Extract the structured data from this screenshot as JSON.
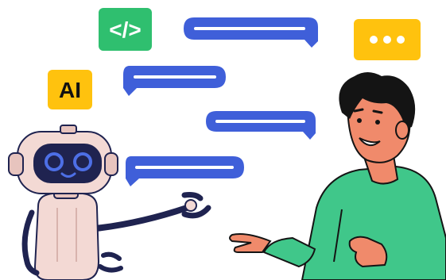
{
  "badges": {
    "code": {
      "text": "</>",
      "icon": "code-brackets-icon",
      "color": "#2fbf6f"
    },
    "ai": {
      "text": "AI",
      "color": "#ffc20e"
    },
    "typing": {
      "icon": "ellipsis-dots-icon",
      "color": "#ffc20e"
    }
  },
  "chat": {
    "bubble_color": "#3f5fd9",
    "line_color": "#ffffff",
    "bubbles": [
      {
        "side": "right",
        "icon": "speech-bubble-icon"
      },
      {
        "side": "left",
        "icon": "speech-bubble-icon"
      },
      {
        "side": "right",
        "icon": "speech-bubble-icon"
      },
      {
        "side": "left",
        "icon": "speech-bubble-icon"
      }
    ]
  },
  "characters": {
    "robot": {
      "body_color": "#f3d9d4",
      "visor_color": "#1f2350",
      "eye_color": "#4d6fe6"
    },
    "person": {
      "hair_color": "#141414",
      "skin_color": "#f08a6b",
      "shirt_color": "#40c78a"
    }
  }
}
